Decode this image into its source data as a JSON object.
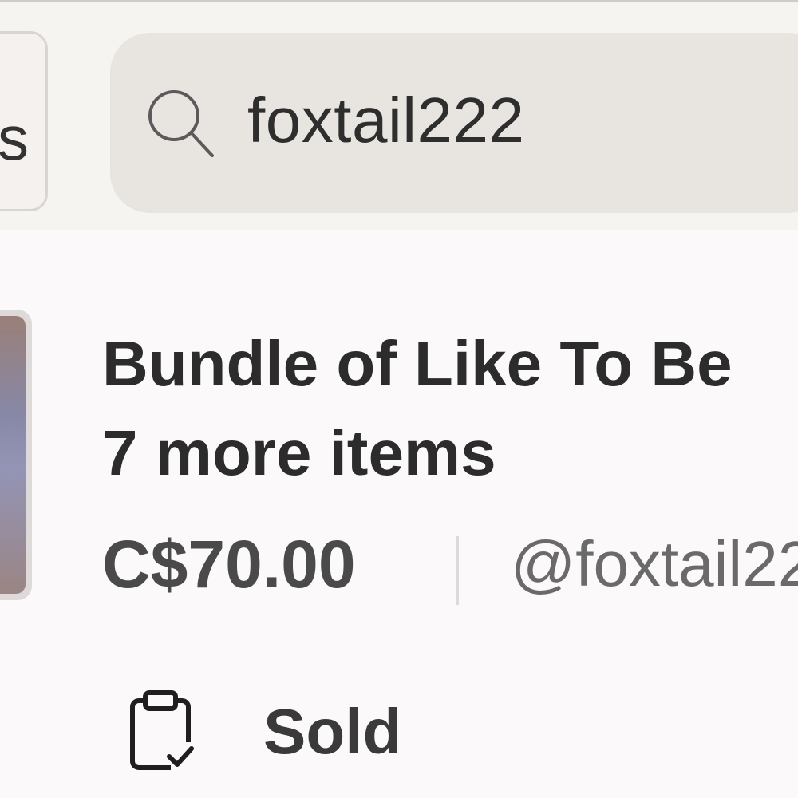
{
  "filter": {
    "chip_label": "s"
  },
  "search": {
    "value": "foxtail222",
    "icon": "search-icon"
  },
  "listing": {
    "title_line1": "Bundle of Like To Be",
    "title_line2": "7 more items",
    "price": "C$70.00",
    "seller": "@foxtail22",
    "status": "Sold",
    "status_icon": "clipboard-check-icon"
  }
}
